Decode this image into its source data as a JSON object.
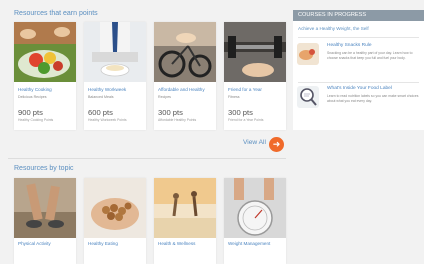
{
  "colors": {
    "accent": "#5b8fc0",
    "button": "#f06a2a",
    "sidebar_header": "#8c9aa6"
  },
  "main": {
    "earn_title": "Resources that earn points",
    "earn_cards": [
      {
        "name": "Healthy Cooking",
        "category": "Delicious Recipes",
        "points": "900 pts",
        "earn": "Healthy Cooking Points"
      },
      {
        "name": "Healthy Workweek",
        "category": "Balanced Meals",
        "points": "600 pts",
        "earn": "Healthy Workweek Points"
      },
      {
        "name": "Affordable and Healthy",
        "category": "Recipes",
        "points": "300 pts",
        "earn": "Affordable Healthy Points"
      },
      {
        "name": "Friend for a Year",
        "category": "Fitness",
        "points": "300 pts",
        "earn": "Friend for a Year Points"
      }
    ],
    "view_all_label": "View All",
    "view_all_icon": "arrow-right-icon",
    "topic_title": "Resources by topic",
    "topic_cards": [
      {
        "name": "Physical Activity"
      },
      {
        "name": "Healthy Eating"
      },
      {
        "name": "Health & Wellness"
      },
      {
        "name": "Weight Management"
      }
    ]
  },
  "sidebar": {
    "header": "COURSES IN PROGRESS",
    "subtitle": "Achieve a Healthy Weight, the Self",
    "courses": [
      {
        "title": "Healthy Snacks Rule",
        "desc": "Snacking can be a healthy part of your day. Learn how to choose snacks that keep you full and fuel your body."
      },
      {
        "title": "What's Inside Your Food Label",
        "desc": "Learn to read nutrition labels so you can make smart choices about what you eat every day."
      }
    ]
  }
}
